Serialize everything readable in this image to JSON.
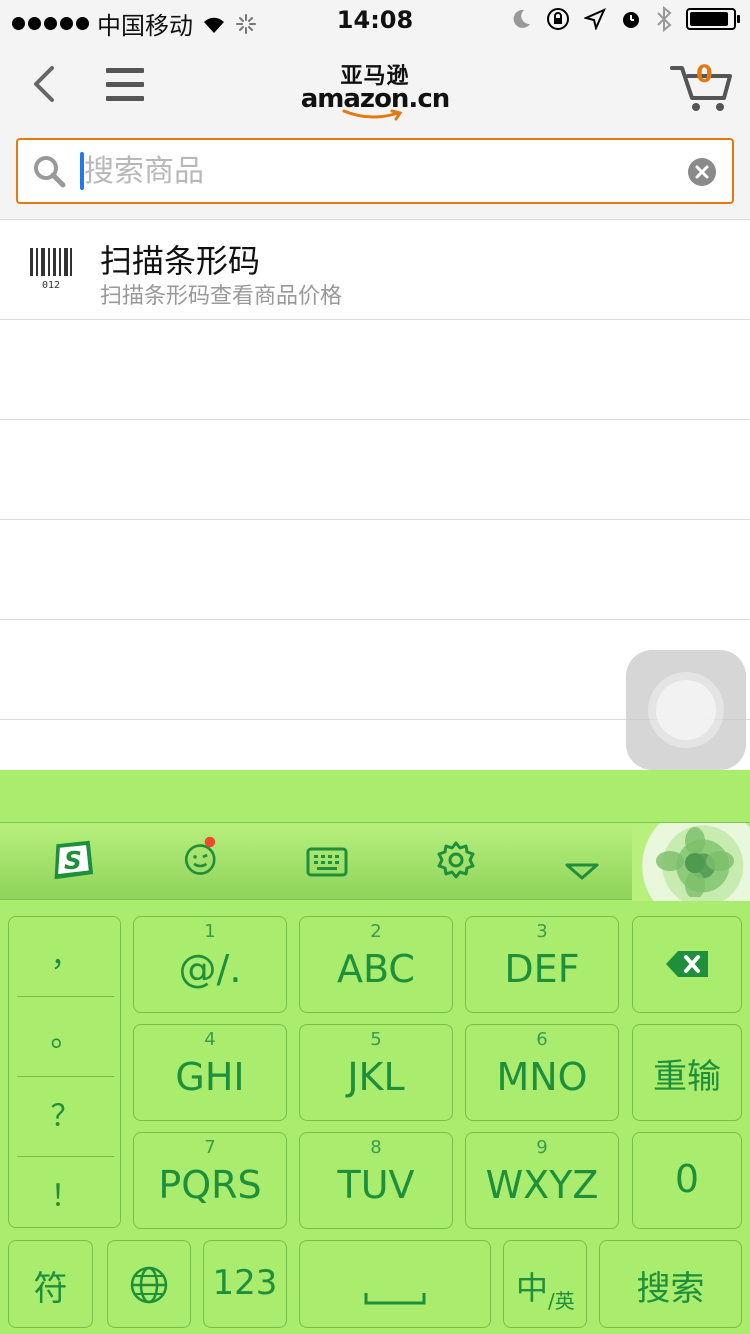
{
  "status_bar": {
    "carrier": "中国移动",
    "time": "14:08"
  },
  "header": {
    "logo_cn": "亚马逊",
    "logo_en": "amazon.cn",
    "cart_count": "0"
  },
  "search": {
    "placeholder": "搜索商品",
    "value": ""
  },
  "scan": {
    "title": "扫描条形码",
    "subtitle": "扫描条形码查看商品价格",
    "barcode_digits": "012"
  },
  "keyboard": {
    "toolbar": [
      "sogou-logo-icon",
      "emoji-icon",
      "keyboard-icon",
      "settings-icon",
      "collapse-icon"
    ],
    "punctuation": [
      "，",
      "。",
      "？",
      "！"
    ],
    "keys": [
      {
        "num": "1",
        "label": "@/."
      },
      {
        "num": "2",
        "label": "ABC"
      },
      {
        "num": "3",
        "label": "DEF"
      },
      {
        "num": "4",
        "label": "GHI"
      },
      {
        "num": "5",
        "label": "JKL"
      },
      {
        "num": "6",
        "label": "MNO"
      },
      {
        "num": "7",
        "label": "PQRS"
      },
      {
        "num": "8",
        "label": "TUV"
      },
      {
        "num": "9",
        "label": "WXYZ"
      }
    ],
    "reinput_label": "重输",
    "zero_label": "0",
    "symbol_label": "符",
    "num_label": "123",
    "lang_label": "中",
    "lang_sub": "/英",
    "search_label": "搜索",
    "accent_color": "#1e8f3a",
    "background_color": "#a9ec6e"
  },
  "colors": {
    "amazon_orange": "#e47911",
    "caret_blue": "#2479e6"
  }
}
